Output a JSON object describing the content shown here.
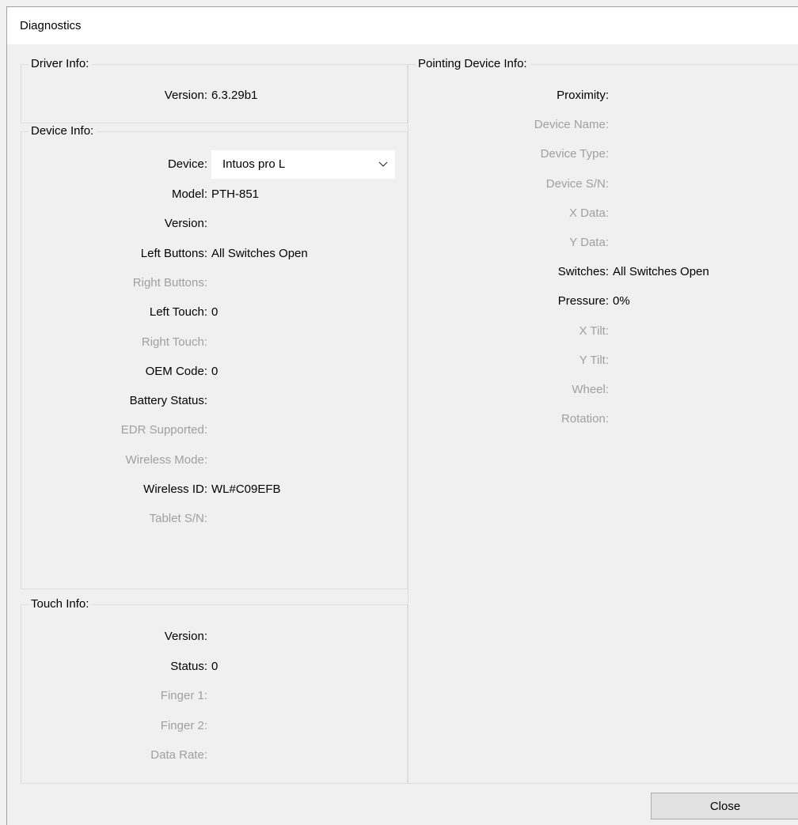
{
  "window": {
    "title": "Diagnostics"
  },
  "driver_info": {
    "title": "Driver Info:",
    "version_label": "Version:",
    "version_value": "6.3.29b1"
  },
  "device_info": {
    "title": "Device Info:",
    "device_label": "Device:",
    "device_selected": "Intuos pro L",
    "rows": [
      {
        "label": "Model:",
        "value": "PTH-851",
        "enabled": true
      },
      {
        "label": "Version:",
        "value": "",
        "enabled": true
      },
      {
        "label": "Left Buttons:",
        "value": "All Switches Open",
        "enabled": true
      },
      {
        "label": "Right Buttons:",
        "value": "",
        "enabled": false
      },
      {
        "label": "Left Touch:",
        "value": "0",
        "enabled": true
      },
      {
        "label": "Right Touch:",
        "value": "",
        "enabled": false
      },
      {
        "label": "OEM Code:",
        "value": "0",
        "enabled": true
      },
      {
        "label": "Battery Status:",
        "value": "",
        "enabled": true
      },
      {
        "label": "EDR Supported:",
        "value": "",
        "enabled": false
      },
      {
        "label": "Wireless Mode:",
        "value": "",
        "enabled": false
      },
      {
        "label": "Wireless ID:",
        "value": "WL#C09EFB",
        "enabled": true
      },
      {
        "label": "Tablet S/N:",
        "value": "",
        "enabled": false
      }
    ]
  },
  "touch_info": {
    "title": "Touch Info:",
    "rows": [
      {
        "label": "Version:",
        "value": "",
        "enabled": true
      },
      {
        "label": "Status:",
        "value": "0",
        "enabled": true
      },
      {
        "label": "Finger 1:",
        "value": "",
        "enabled": false
      },
      {
        "label": "Finger 2:",
        "value": "",
        "enabled": false
      },
      {
        "label": "Data Rate:",
        "value": "",
        "enabled": false
      }
    ]
  },
  "pointing_device_info": {
    "title": "Pointing Device Info:",
    "rows": [
      {
        "label": "Proximity:",
        "value": "",
        "enabled": true
      },
      {
        "label": "Device Name:",
        "value": "",
        "enabled": false
      },
      {
        "label": "Device Type:",
        "value": "",
        "enabled": false
      },
      {
        "label": "Device S/N:",
        "value": "",
        "enabled": false
      },
      {
        "label": "X Data:",
        "value": "",
        "enabled": false
      },
      {
        "label": "Y Data:",
        "value": "",
        "enabled": false
      },
      {
        "label": "Switches:",
        "value": "All Switches Open",
        "enabled": true
      },
      {
        "label": "Pressure:",
        "value": "0%",
        "enabled": true
      },
      {
        "label": "X Tilt:",
        "value": "",
        "enabled": false
      },
      {
        "label": "Y Tilt:",
        "value": "",
        "enabled": false
      },
      {
        "label": "Wheel:",
        "value": "",
        "enabled": false
      },
      {
        "label": "Rotation:",
        "value": "",
        "enabled": false
      }
    ]
  },
  "buttons": {
    "close_label": "Close"
  },
  "icons": {
    "dropdown": "chevron-down-icon"
  }
}
